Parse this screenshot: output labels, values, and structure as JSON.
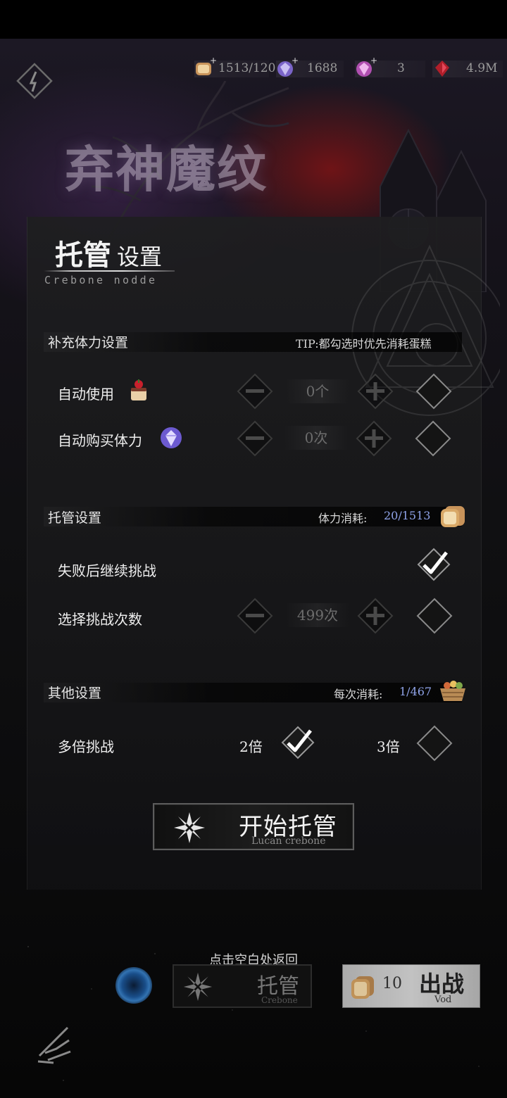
{
  "resources": [
    {
      "name": "bread-stamina",
      "value": "1513/120"
    },
    {
      "name": "purple-crystal",
      "value": "1688"
    },
    {
      "name": "pink-crystal",
      "value": "3"
    },
    {
      "name": "red-gem",
      "value": "4.9M"
    }
  ],
  "game_title": "弃神魔纹",
  "panel": {
    "title_main": "托管",
    "title_sub": "设置",
    "title_en": "Crebone nodde"
  },
  "section_stamina": {
    "title": "补充体力设置",
    "tip": "TIP:都勾选时优先消耗蛋糕",
    "rows": [
      {
        "label": "自动使用",
        "value": "0个",
        "checked": false
      },
      {
        "label": "自动购买体力",
        "value": "0次",
        "checked": false
      }
    ]
  },
  "section_auto": {
    "title": "托管设置",
    "cost_label": "体力消耗:",
    "cost_value": "20/1513",
    "retry_label": "失败后继续挑战",
    "retry_checked": true,
    "count_label": "选择挑战次数",
    "count_value": "499次",
    "count_checked": false
  },
  "section_other": {
    "title": "其他设置",
    "cost_label": "每次消耗:",
    "cost_value": "1/467",
    "multi_label": "多倍挑战",
    "x2_label": "2倍",
    "x2_checked": true,
    "x3_label": "3倍",
    "x3_checked": false
  },
  "start_button": {
    "label": "开始托管",
    "en": "Lucan crebone"
  },
  "bottom": {
    "hint": "点击空白处返回",
    "tuoguan_label": "托管",
    "tuoguan_en": "Crebone",
    "fight_cost": "10",
    "fight_label": "出战",
    "fight_en": "Vod"
  },
  "colors": {
    "accent_blue": "#8fa3e8",
    "panel_bg": "#1e1e20"
  }
}
